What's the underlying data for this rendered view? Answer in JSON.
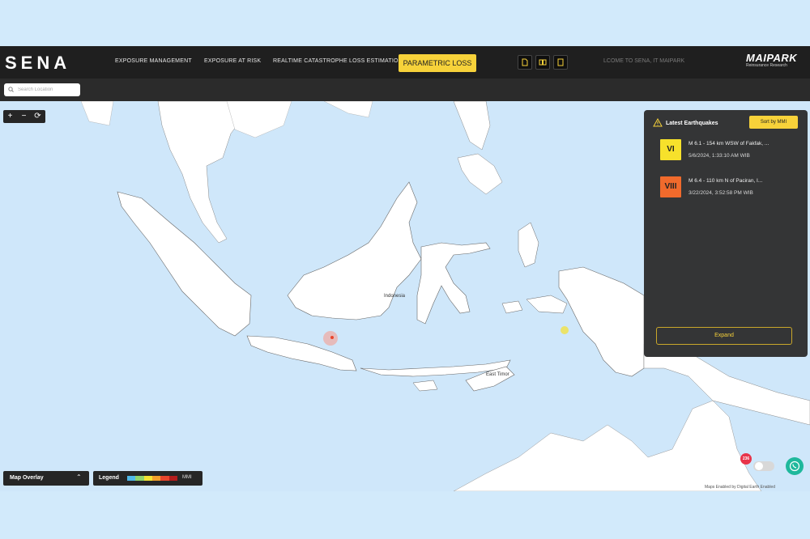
{
  "header": {
    "logo": "SENA",
    "nav": [
      {
        "label": "EXPOSURE MANAGEMENT"
      },
      {
        "label": "EXPOSURE AT RISK"
      },
      {
        "label": "REALTIME CATASTROPHE LOSS ESTIMATION"
      },
      {
        "label": "PARAMETRIC LOSS"
      }
    ],
    "active_nav": "PARAMETRIC LOSS",
    "doc_icons": [
      "document-icon",
      "book-icon",
      "tablet-icon"
    ],
    "welcome": "LCOME TO SENA, IT MAIPARK",
    "brand_name": "MAIPARK",
    "brand_sub": "Reinsurance Research"
  },
  "search": {
    "placeholder": "Search Location"
  },
  "zoom_controls": [
    "+",
    "−",
    "⟳"
  ],
  "map": {
    "labels": {
      "indonesia": "Indonesia",
      "east_timor": "East Timor"
    }
  },
  "earthquakes": {
    "title": "Latest Earthquakes",
    "sort_label": "Sort by MMI",
    "items": [
      {
        "mmi": "VI",
        "color": "#f7e12b",
        "description": "M 6.1 - 154 km WSW of Fakfak, ...",
        "time": "5/6/2024, 1:33:10 AM WIB"
      },
      {
        "mmi": "VIII",
        "color": "#f06a2c",
        "description": "M 6.4 - 110 km N of Paciran, I...",
        "time": "3/22/2024, 3:52:58 PM WIB"
      }
    ],
    "expand_label": "Expand"
  },
  "overlay": {
    "label": "Map Overlay"
  },
  "legend": {
    "label": "Legend",
    "unit": "MMI",
    "colors": [
      "#4fb8e8",
      "#8fd36b",
      "#f3e233",
      "#f3a02b",
      "#e8452c",
      "#b31d1d"
    ]
  },
  "badge": {
    "count": "236"
  },
  "credit": "Maps Enabled by   Digital Earth Enabled",
  "colors": {
    "accent": "#f7d23a",
    "panel": "#343536",
    "header": "#1f1f1f"
  }
}
